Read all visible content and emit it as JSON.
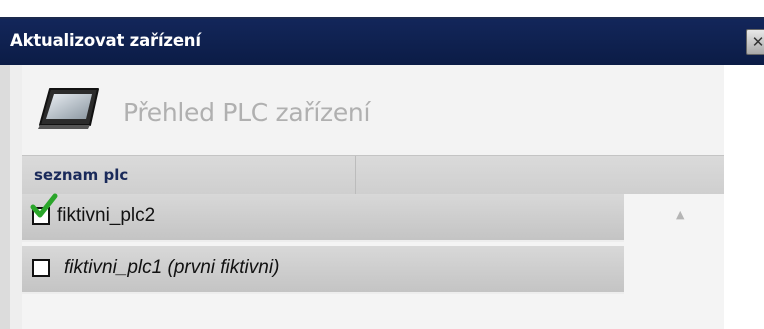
{
  "window": {
    "title": "Aktualizovat zařízení",
    "close_glyph": "✕"
  },
  "header": {
    "icon": "monitor-icon",
    "title": "Přehled PLC zařízení"
  },
  "table": {
    "column_header": "seznam plc",
    "rows": [
      {
        "label": "fiktivni_plc2",
        "checked": true,
        "italic": false
      },
      {
        "label": "fiktivni_plc1 (prvni fiktivni)",
        "checked": false,
        "italic": true
      }
    ]
  },
  "colors": {
    "titlebar": "#0b1c46",
    "checkmark": "#2aa52a",
    "section_title": "#b0b0b0"
  }
}
